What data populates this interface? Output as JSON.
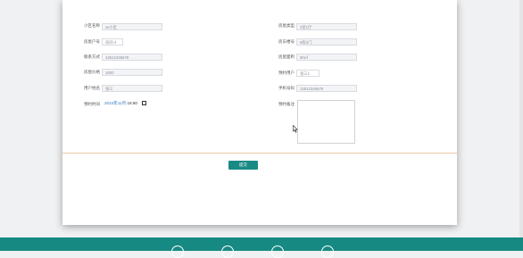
{
  "form": {
    "left": [
      {
        "label": "小区名称",
        "value": "ss小区"
      },
      {
        "label": "房屋户号",
        "value": "房间-4"
      },
      {
        "label": "联系方式",
        "value": "13512345678"
      },
      {
        "label": "房屋价格",
        "value": "1800"
      },
      {
        "label": "用户姓名",
        "value": "张三"
      }
    ],
    "right": [
      {
        "label": "房屋类型",
        "value": "3室1厅"
      },
      {
        "label": "房东楼号",
        "value": "8栋3门"
      },
      {
        "label": "房屋面积",
        "value": "90㎡"
      },
      {
        "label": "预约用户",
        "value": "张三1"
      },
      {
        "label": "手机号码",
        "value": "13512345678"
      }
    ],
    "appointment_time_label": "预约时间",
    "appointment_date": "2024年11月",
    "appointment_time": " 16:50",
    "remark_label": "预约备注"
  },
  "submit_label": "提交",
  "colors": {
    "accent": "#1a8a85",
    "footer": "#168a82",
    "divider": "#e8c9a0"
  },
  "footer_icons": [
    "home-icon",
    "user-icon",
    "phone-icon",
    "info-icon"
  ]
}
